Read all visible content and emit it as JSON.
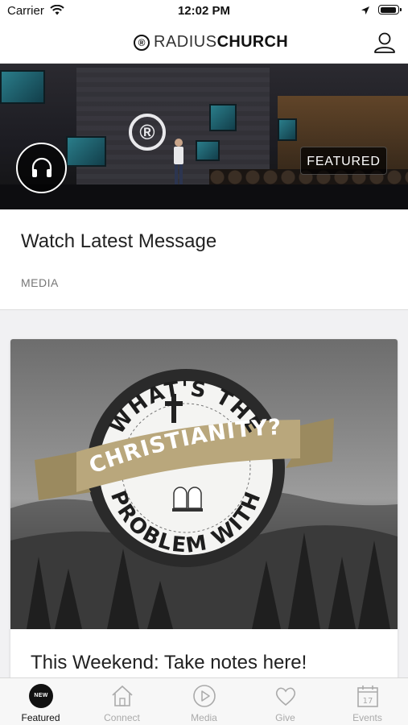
{
  "status_bar": {
    "carrier": "Carrier",
    "time": "12:02 PM",
    "icons": [
      "wifi-icon",
      "location-arrow-icon",
      "battery-icon"
    ]
  },
  "nav_bar": {
    "brand_light": "RADIUS",
    "brand_bold": "CHURCH",
    "brand_mark": "®",
    "profile_icon": "user-icon"
  },
  "hero": {
    "badge": "FEATURED",
    "audio_icon": "headphones-icon",
    "stage_logo": "®"
  },
  "message_card": {
    "title": "Watch Latest Message",
    "tag": "MEDIA"
  },
  "weekend_card": {
    "art_top": "WHAT'S THE",
    "art_banner": "CHRISTIANITY?",
    "art_bottom": "PROBLEM WITH",
    "title": "This Weekend: Take notes here!"
  },
  "tab_bar": {
    "tabs": [
      {
        "label": "Featured",
        "icon": "new-badge-icon",
        "badge": "NEW",
        "active": true
      },
      {
        "label": "Connect",
        "icon": "house-icon",
        "active": false
      },
      {
        "label": "Media",
        "icon": "play-circle-icon",
        "active": false
      },
      {
        "label": "Give",
        "icon": "heart-icon",
        "active": false
      },
      {
        "label": "Events",
        "icon": "calendar-icon",
        "badge": "17",
        "active": false
      }
    ]
  },
  "colors": {
    "background": "#f1f1f3",
    "banner_gold": "#b9a77c",
    "active_tab": "#111111",
    "inactive_tab": "#aaaaaa"
  }
}
